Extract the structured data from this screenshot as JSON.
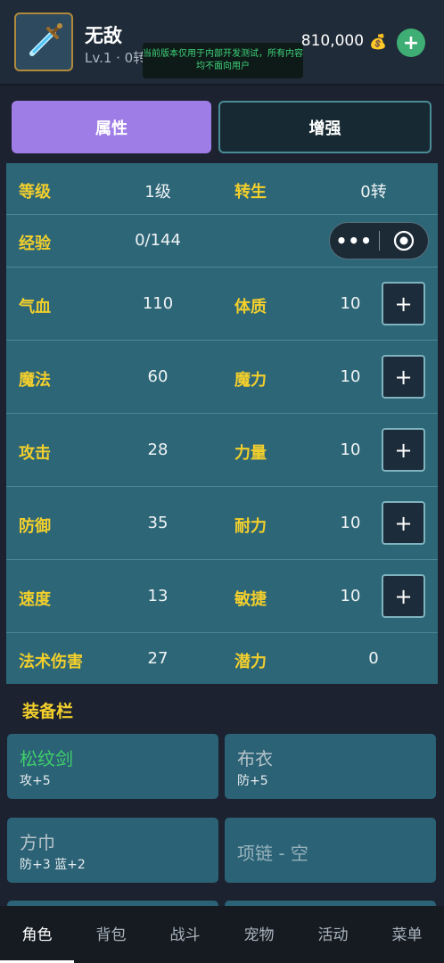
{
  "header": {
    "name": "无敌",
    "level_text": "Lv.1 · 0转",
    "notice": "当前版本仅用于内部开发测试，所有内容均不面向用户",
    "gold": "810,000",
    "gold_icon": "money-bag-icon",
    "add_label": "+"
  },
  "tabs": [
    {
      "label": "属性",
      "active": true
    },
    {
      "label": "增强",
      "active": false
    }
  ],
  "stats": {
    "level": {
      "label": "等级",
      "value": "1级"
    },
    "rebirth": {
      "label": "转生",
      "value": "0转"
    },
    "exp": {
      "label": "经验",
      "value": "0/144"
    },
    "hp": {
      "label": "气血",
      "value": "110"
    },
    "con": {
      "label": "体质",
      "value": "10"
    },
    "mp": {
      "label": "魔法",
      "value": "60"
    },
    "mag": {
      "label": "魔力",
      "value": "10"
    },
    "atk": {
      "label": "攻击",
      "value": "28"
    },
    "str": {
      "label": "力量",
      "value": "10"
    },
    "def": {
      "label": "防御",
      "value": "35"
    },
    "end": {
      "label": "耐力",
      "value": "10"
    },
    "spd": {
      "label": "速度",
      "value": "13"
    },
    "agi": {
      "label": "敏捷",
      "value": "10"
    },
    "spell": {
      "label": "法术伤害",
      "value": "27"
    },
    "pot": {
      "label": "潜力",
      "value": "0"
    },
    "plus_label": "+"
  },
  "capsule": {
    "more": "•••"
  },
  "equipment": {
    "title": "装备栏",
    "slots": [
      {
        "name": "松纹剑",
        "stat": "攻+5",
        "color": "#3fcf6a"
      },
      {
        "name": "布衣",
        "stat": "防+5",
        "color": "#b7c3c9"
      },
      {
        "name": "方巾",
        "stat": "防+3 蓝+2",
        "color": "#b7c3c9"
      },
      {
        "name": "项链 - 空",
        "stat": ""
      }
    ]
  },
  "nav": [
    {
      "label": "角色",
      "active": true
    },
    {
      "label": "背包"
    },
    {
      "label": "战斗"
    },
    {
      "label": "宠物"
    },
    {
      "label": "活动"
    },
    {
      "label": "菜单"
    }
  ],
  "colors": {
    "accent_purple": "#9f7de6",
    "stat_label_yellow": "#f2cf2c",
    "panel_teal": "#2d6677",
    "item_green": "#3fcf6a"
  }
}
